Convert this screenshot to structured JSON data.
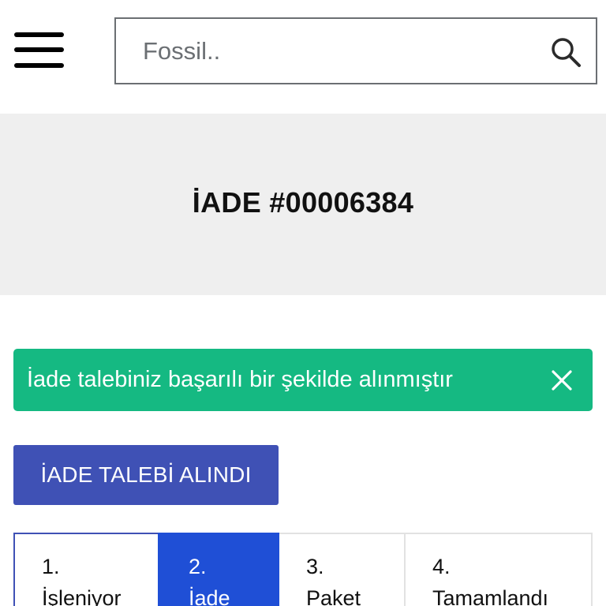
{
  "header": {
    "menu_icon": "hamburger-menu-icon",
    "search": {
      "value": "",
      "placeholder": "Fossil..",
      "icon": "search-icon"
    }
  },
  "hero": {
    "title": "İADE #00006384"
  },
  "alert": {
    "message": "İade talebiniz başarılı bir şekilde alınmıştır",
    "close_icon": "close-icon",
    "color": "#15b982"
  },
  "status_button": {
    "label": "İADE TALEBİ ALINDI",
    "color": "#3f51b5"
  },
  "steps": [
    {
      "number": "1.",
      "label": "İşleniyor"
    },
    {
      "number": "2.",
      "label": "İade"
    },
    {
      "number": "3.",
      "label": "Paket"
    },
    {
      "number": "4.",
      "label": "Tamamlandı"
    }
  ],
  "active_step_color": "#1f4fd6"
}
